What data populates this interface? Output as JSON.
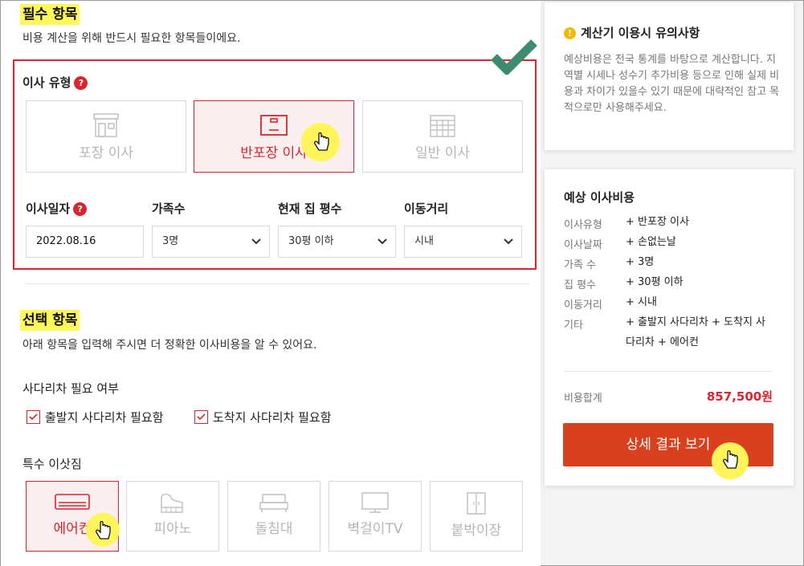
{
  "required": {
    "title": "필수 항목",
    "subtitle": "비용 계산을 위해 반드시 필요한 항목들이에요.",
    "move_type_label": "이사 유형",
    "help_mark": "?",
    "move_types": [
      {
        "label": "포장 이사",
        "icon": "store-icon"
      },
      {
        "label": "반포장 이사",
        "icon": "box-icon"
      },
      {
        "label": "일반 이사",
        "icon": "building-icon"
      }
    ],
    "selected_move_type": "반포장 이사",
    "date_label": "이사일자",
    "date_value": "2022.08.16",
    "family_label": "가족수",
    "family_value": "3명",
    "size_label": "현재 집 평수",
    "size_value": "30평 이하",
    "distance_label": "이동거리",
    "distance_value": "시내"
  },
  "optional": {
    "title": "선택 항목",
    "subtitle": "아래 항목을 입력해 주시면 더 정확한 이사비용을 알 수 있어요.",
    "ladder_label": "사다리차 필요 여부",
    "ladder_options": [
      {
        "label": "출발지 사다리차 필요함",
        "checked": true
      },
      {
        "label": "도착지 사다리차 필요함",
        "checked": true
      }
    ],
    "special_label": "특수 이삿짐",
    "special_items": [
      {
        "label": "에어컨",
        "icon": "air-conditioner-icon",
        "selected": true
      },
      {
        "label": "피아노",
        "icon": "piano-icon",
        "selected": false
      },
      {
        "label": "돌침대",
        "icon": "bed-icon",
        "selected": false
      },
      {
        "label": "벽걸이TV",
        "icon": "tv-icon",
        "selected": false
      },
      {
        "label": "붙박이장",
        "icon": "wardrobe-icon",
        "selected": false
      }
    ]
  },
  "notice": {
    "icon_glyph": "!",
    "title": "계산기 이용시 유의사항",
    "body": "예상비용은 전국 통계를 바탕으로 계산합니다. 지역별 시세나 성수기 추가비용 등으로 인해 실제 비용과 차이가 있을수 있기 때문에 대략적인 참고 목적으로만 사용해주세요."
  },
  "estimate": {
    "title": "예상 이사비용",
    "rows": [
      {
        "key": "이사유형",
        "value": "+ 반포장 이사"
      },
      {
        "key": "이사날짜",
        "value": "+ 손없는날"
      },
      {
        "key": "가족 수",
        "value": "+ 3명"
      },
      {
        "key": "집 평수",
        "value": "+ 30평 이하"
      },
      {
        "key": "이동거리",
        "value": "+ 시내"
      },
      {
        "key": "기타",
        "value": "+ 출발지 사다리차 + 도착지 사다리차 + 에어컨"
      }
    ],
    "total_label": "비용합계",
    "total_value": "857,500원",
    "detail_button": "상세 결과 보기"
  },
  "colors": {
    "accent_red": "#d9252e",
    "button_orange": "#d9401e",
    "highlight_yellow": "#fff85a",
    "check_green": "#3e8c70"
  }
}
